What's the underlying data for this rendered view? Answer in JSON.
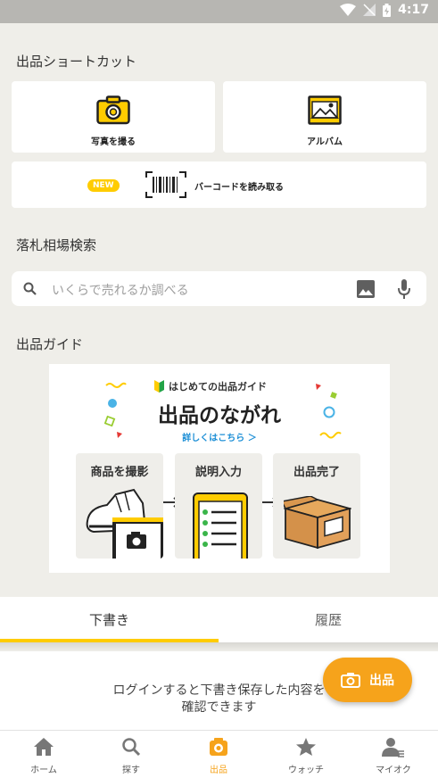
{
  "status_bar": {
    "time": "4:17"
  },
  "shortcuts": {
    "title": "出品ショートカット",
    "camera_label": "写真を撮る",
    "album_label": "アルバム",
    "barcode_badge": "NEW",
    "barcode_label": "バーコードを読み取る"
  },
  "price_search": {
    "title": "落札相場検索",
    "placeholder": "いくらで売れるか調べる"
  },
  "guide": {
    "title": "出品ガイド",
    "banner_subtitle": "はじめての出品ガイド",
    "banner_heading": "出品のながれ",
    "details_link": "詳しくはこちら ＞",
    "steps": [
      "商品を撮影",
      "説明入力",
      "出品完了"
    ]
  },
  "tabs": [
    {
      "label": "下書き",
      "active": true
    },
    {
      "label": "履歴",
      "active": false
    }
  ],
  "drafts": {
    "message_line1": "ログインすると下書き保存した内容を",
    "message_line2": "確認できます"
  },
  "fab": {
    "label": "出品"
  },
  "bottom_nav": [
    {
      "label": "ホーム",
      "icon": "home-icon"
    },
    {
      "label": "探す",
      "icon": "search-icon"
    },
    {
      "label": "出品",
      "icon": "camera-icon",
      "active": true
    },
    {
      "label": "ウォッチ",
      "icon": "star-icon"
    },
    {
      "label": "マイオク",
      "icon": "person-icon"
    }
  ],
  "colors": {
    "accent_yellow": "#ffcc00",
    "orange": "#f6a31b",
    "background": "#efeee9"
  }
}
